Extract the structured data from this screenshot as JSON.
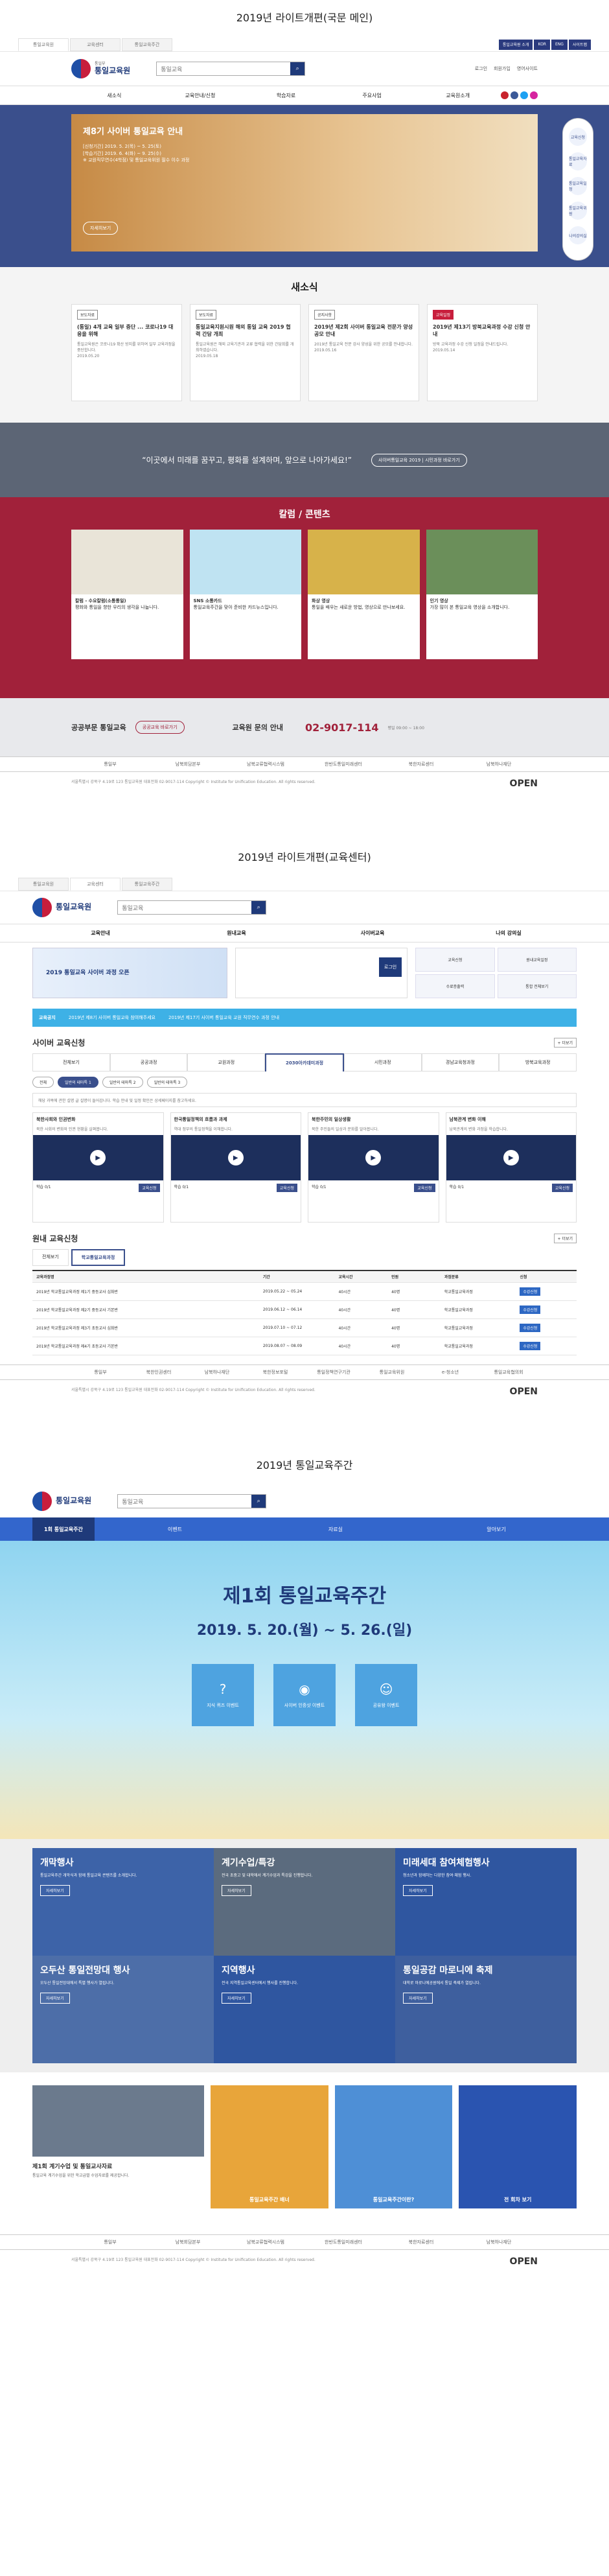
{
  "s1": {
    "title": "2019년 라이트개편(국문 메인)",
    "top_tabs": [
      "통일교육원",
      "교육센터",
      "통일교육주간"
    ],
    "top_right": [
      "통일교육원 소개",
      "KOR",
      "ENG",
      "사이트맵"
    ],
    "logo_badge": "통일부",
    "logo": "통일교육원",
    "search_ph": "통일교육",
    "hlinks": [
      "로그인",
      "회원가입",
      "영어사이트"
    ],
    "gnb": [
      "새소식",
      "교육안내/신청",
      "학습자료",
      "주요사업",
      "교육원소개"
    ],
    "hero_title": "제8기 사이버 통일교육 안내",
    "hero_lines": [
      "[신청기간] 2019. 5. 2(목) ~ 5. 25(토)",
      "[학습기간] 2019. 6. 4(화) ~ 9. 25(수)",
      "※ 교원직무연수(4학점) 및 통일교육위원 필수 이수 과정"
    ],
    "hero_more": "자세히보기",
    "quick": [
      "교육신청",
      "통일교육자료",
      "통일교육일정",
      "통일교육위원",
      "나의강의실"
    ],
    "news_title": "새소식",
    "news": [
      {
        "tag": "보도자료",
        "title": "(통일) 4개 교육 일부 중단 ... 코로나19 대응을 위해",
        "desc": "통일교육원은 코로나19 확산 방지를 위하여 일부 교육과정을 중단합니다.",
        "date": "2019.05.20"
      },
      {
        "tag": "보도자료",
        "title": "통일교육지원시원 해외 통일 교육 2019 협력 간담 개최",
        "desc": "통일교육원은 해외 교육기관과 교류 협력을 위한 간담회를 개최하였습니다.",
        "date": "2019.05.18"
      },
      {
        "tag": "공지사항",
        "title": "2019년 제2회 사이버 통일교육 전문가 양성 공모 안내",
        "desc": "2019년 통일교육 전문 강사 양성을 위한 공모를 안내합니다.",
        "date": "2019.05.16"
      },
      {
        "tag": "교육일정",
        "title": "2019년 제13기 방북교육과정 수강 신청 안내",
        "desc": "방북 교육과정 수강 신청 일정을 안내드립니다.",
        "date": "2019.05.14"
      }
    ],
    "quote": "“이곳에서 미래를 꿈꾸고, 평화를 설계하며, 앞으로 나아가세요!”",
    "quote_btn": "사이버통일교육 2019 | 시민과정 바로가기",
    "col_title": "칼럼 / 콘텐츠",
    "cols": [
      {
        "title": "칼럼 - 수요칼럼(소통통일)",
        "desc": "평화와 통일을 향한 우리의 생각을 나눕니다."
      },
      {
        "title": "SNS 소통카드",
        "desc": "통일교육주간을 맞아 준비한 카드뉴스입니다."
      },
      {
        "title": "화상 영상",
        "desc": "통일을 배우는 새로운 방법, 영상으로 만나보세요."
      },
      {
        "title": "인기 영상",
        "desc": "가장 많이 본 통일교육 영상을 소개합니다."
      }
    ],
    "contact_lbl": "공공부문 통일교육",
    "contact_btn": "공공교육 바로가기",
    "contact2": "교육원 문의 안내",
    "phone": "02-9017-114",
    "phone_sub": "평일 09:00 ~ 18:00",
    "fsites": [
      "통일부",
      "남북회담본부",
      "남북교류협력시스템",
      "한반도통일미래센터",
      "북한자료센터",
      "남북하나재단"
    ],
    "footer": "서울특별시 강북구 4.19로 123 통일교육원  대표전화 02-9017-114  Copyright © Institute for Unification Education. All rights reserved.",
    "open": "OPEN"
  },
  "s2": {
    "title": "2019년 라이트개편(교육센터)",
    "top_tabs": [
      "통일교육원",
      "교육센터",
      "통일교육주간"
    ],
    "gnb": [
      "교육안내",
      "원내교육",
      "사이버교육",
      "나의 강의실"
    ],
    "ban_txt": "2019 통일교육 사이버 과정 오픈",
    "login_lbl": "로그인",
    "quick": [
      "교육신청",
      "원내교육일정",
      "수료증출력",
      "통합 전체보기"
    ],
    "notice_tag": "교육공지",
    "notice1": "2019년 제8기 사이버 통일교육 참여해주세요",
    "notice2": "2019년 제17기 사이버 통일교육 교원 직무연수 과정 안내",
    "cyber_title": "사이버 교육신청",
    "more": "+ 더보기",
    "tabs": [
      "전체보기",
      "공공과정",
      "교원과정",
      "2030아카데미과정",
      "시민과정",
      "경남교육청과정",
      "방북교육과정"
    ],
    "subtabs": [
      "전체",
      "일반의 테마특 1",
      "일반의 테마특 2",
      "일반의 테마특 3"
    ],
    "info": "해당 과목에 관한 설명 글 설명이 들어갑니다. 학습 안내 및 일정 확인은 상세페이지를 참고하세요.",
    "vcards": [
      {
        "title": "북한사회와 인권변화",
        "desc": "북한 사회의 변화와 인권 현황을 살펴봅니다.",
        "meta": "학습 0/1"
      },
      {
        "title": "한국통일정책의 흐름과 과제",
        "desc": "역대 정부의 통일정책을 이해합니다.",
        "meta": "학습 0/1"
      },
      {
        "title": "북한주민의 일상생활",
        "desc": "북한 주민들의 일상과 문화를 알아봅니다.",
        "meta": "학습 0/1"
      },
      {
        "title": "남북관계 변화 이해",
        "desc": "남북관계의 변화 과정을 학습합니다.",
        "meta": "학습 0/1"
      }
    ],
    "apply": "교육신청",
    "inner_title": "원내 교육신청",
    "inner_tabs": [
      "전체보기",
      "학교통일교육과정"
    ],
    "cols": [
      "교육과정명",
      "기간",
      "교육시간",
      "인원",
      "과정분류",
      "신청"
    ],
    "rows": [
      [
        "2019년 학교통일교육과정 제1기 중등교사 심화반",
        "2019.05.22 ~ 05.24",
        "40시간",
        "40명",
        "학교통일교육과정",
        "수강신청"
      ],
      [
        "2019년 학교통일교육과정 제2기 중등교사 기본반",
        "2019.06.12 ~ 06.14",
        "40시간",
        "40명",
        "학교통일교육과정",
        "수강신청"
      ],
      [
        "2019년 학교통일교육과정 제3기 초등교사 심화반",
        "2019.07.10 ~ 07.12",
        "40시간",
        "40명",
        "학교통일교육과정",
        "수강신청"
      ],
      [
        "2019년 학교통일교육과정 제4기 초등교사 기본반",
        "2019.08.07 ~ 08.09",
        "40시간",
        "40명",
        "학교통일교육과정",
        "수강신청"
      ]
    ],
    "fsites": [
      "통일부",
      "북한인권센터",
      "남북하나재단",
      "북한정보포털",
      "통일정책연구기관",
      "통일교육위원",
      "e-청소년",
      "통일교육협의회"
    ],
    "open": "OPEN"
  },
  "s3": {
    "title": "2019년 통일교육주간",
    "main_first": "1회 통일교육주간",
    "main": [
      "이벤트",
      "자료실",
      "알아보기"
    ],
    "fest_t1": "제1회 통일교육주간",
    "fest_t2": "2019. 5. 20.(월) ~ 5. 26.(일)",
    "icons": [
      "지식 퀴즈 이벤트",
      "사이버 인증샷 이벤트",
      "공유왕 이벤트"
    ],
    "blocks": [
      {
        "t": "개막행사",
        "d": "통일교육주간 개막식과 함께 통일교육 콘텐츠를 소개합니다.",
        "b": "자세히보기"
      },
      {
        "t": "계기수업/특강",
        "d": "전국 초중고 및 대학에서 계기수업과 특강을 진행합니다.",
        "b": "자세히보기"
      },
      {
        "t": "미래세대 참여체험행사",
        "d": "청소년과 함께하는 다양한 참여·체험 행사.",
        "b": "자세히보기"
      },
      {
        "t": "오두산 통일전망대 행사",
        "d": "오두산 통일전망대에서 특별 행사가 열립니다.",
        "b": "자세히보기"
      },
      {
        "t": "지역행사",
        "d": "전국 지역통일교육센터에서 행사를 진행합니다.",
        "b": "자세히보기"
      },
      {
        "t": "통일공감 마로니에 축제",
        "d": "대학로 마로니에공원에서 통일 축제가 열립니다.",
        "b": "자세히보기"
      }
    ],
    "b_title": "제1회 계기수업 및 통일교사자료",
    "b_desc": "통일교육 계기수업을 위한 학교급별 수업자료를 제공합니다.",
    "ctitles": [
      "통일교육주간 배너",
      "통일교육주간이란?",
      "전 회차 보기"
    ],
    "fsites": [
      "통일부",
      "남북회담본부",
      "남북교류협력시스템",
      "한반도통일미래센터",
      "북한자료센터",
      "남북하나재단"
    ],
    "open": "OPEN"
  }
}
